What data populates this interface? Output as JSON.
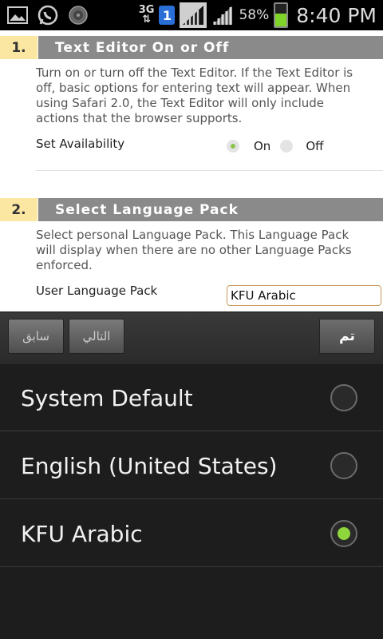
{
  "statusbar": {
    "icons_left": [
      "gallery-icon",
      "whatsapp-icon",
      "media-icon"
    ],
    "network": "3G",
    "sim": "1",
    "battery_percent": "58%",
    "battery_level": 0.58,
    "time": "8:40 PM"
  },
  "sections": [
    {
      "number": "1.",
      "title": "Text Editor On or Off",
      "description": "Turn on or turn off the Text Editor. If the Text Editor is off, basic options for entering text will appear. When using Safari 2.0, the Text Editor will only include actions that the browser supports.",
      "field_label": "Set Availability",
      "options": [
        "On",
        "Off"
      ],
      "selected": "On"
    },
    {
      "number": "2.",
      "title": "Select Language Pack",
      "description": "Select personal Language Pack. This Language Pack will display when there are no other Language Packs enforced.",
      "field_label": "User Language Pack",
      "value": "KFU Arabic"
    }
  ],
  "toolbar": {
    "prev_label": "سابق",
    "next_label": "التالي",
    "done_label": "تم"
  },
  "picker": {
    "options": [
      "System Default",
      "English (United States)",
      "KFU Arabic"
    ],
    "selected": "KFU Arabic"
  },
  "colors": {
    "accent_green": "#8fd63c",
    "section_number_bg": "#fbe6a2",
    "section_title_bg": "#8a8a8a"
  }
}
